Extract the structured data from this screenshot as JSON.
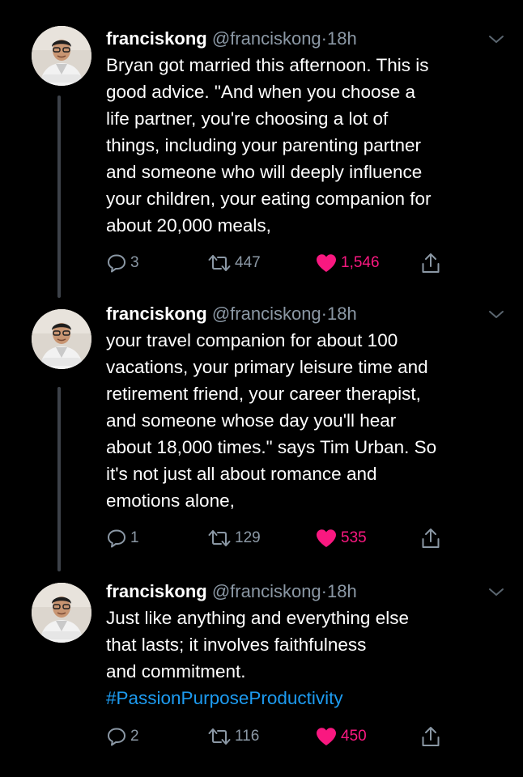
{
  "tweets": [
    {
      "author": {
        "name": "franciskong",
        "handle": "@franciskong",
        "separator": "·",
        "time": "18h"
      },
      "lines": [
        "Bryan got married this afternoon. This is",
        "good advice. \"And when you choose a",
        "life partner, you're choosing a lot of",
        "things, including your parenting partner",
        "and someone who will deeply influence",
        "your children, your eating companion for",
        "about 20,000 meals,"
      ],
      "stats": {
        "replies": "3",
        "retweets": "447",
        "likes": "1,546"
      }
    },
    {
      "author": {
        "name": "franciskong",
        "handle": "@franciskong",
        "separator": "·",
        "time": "18h"
      },
      "lines": [
        "your travel companion for about 100",
        "vacations, your primary leisure time and",
        "retirement friend, your career therapist,",
        "and someone whose day you'll hear",
        "about 18,000 times.\" says Tim Urban. So",
        "it's not just all about romance and",
        "emotions alone,"
      ],
      "stats": {
        "replies": "1",
        "retweets": "129",
        "likes": "535"
      }
    },
    {
      "author": {
        "name": "franciskong",
        "handle": "@franciskong",
        "separator": "·",
        "time": "18h"
      },
      "lines": [
        "Just like anything and everything else",
        "that lasts; it involves faithfulness",
        "and commitment."
      ],
      "hashtag": "#PassionPurposeProductivity",
      "stats": {
        "replies": "2",
        "retweets": "116",
        "likes": "450"
      }
    }
  ],
  "colors": {
    "background": "#000000",
    "text": "#ffffff",
    "secondary": "#8b98a5",
    "like": "#f91880",
    "hashtag": "#1d9bf0",
    "thread_line": "#3d4249"
  },
  "icons": {
    "reply": "speech-bubble-outline",
    "retweet": "retweet-arrows",
    "like": "heart-filled",
    "share": "upload-arrow",
    "menu": "chevron-down"
  }
}
